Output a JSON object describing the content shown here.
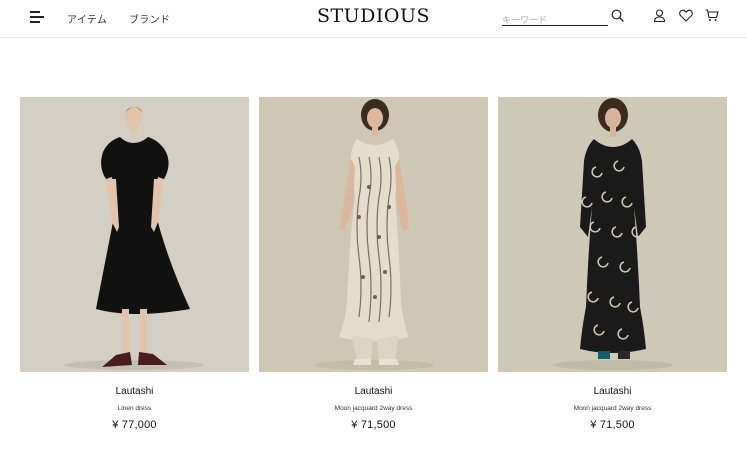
{
  "header": {
    "nav_items_label": "アイテム",
    "nav_brands_label": "ブランド",
    "logo": "STUDIOUS",
    "search_placeholder": "キーワード",
    "icons": [
      "menu-icon",
      "search-icon",
      "user-icon",
      "heart-icon",
      "cart-icon"
    ]
  },
  "products": [
    {
      "brand": "Lautashi",
      "name": "Linen dress",
      "price": "¥ 77,000",
      "dress_color": "#111111",
      "bg_color": "#d3cfc4"
    },
    {
      "brand": "Lautashi",
      "name": "Moon jacquard 2way dress",
      "price": "¥ 71,500",
      "dress_color": "#e4ddcd",
      "bg_color": "#cfc7b6"
    },
    {
      "brand": "Lautashi",
      "name": "Moon jacquard 2way dress",
      "price": "¥ 71,500",
      "dress_color": "#1a1a1a",
      "bg_color": "#cdc8b8"
    }
  ]
}
